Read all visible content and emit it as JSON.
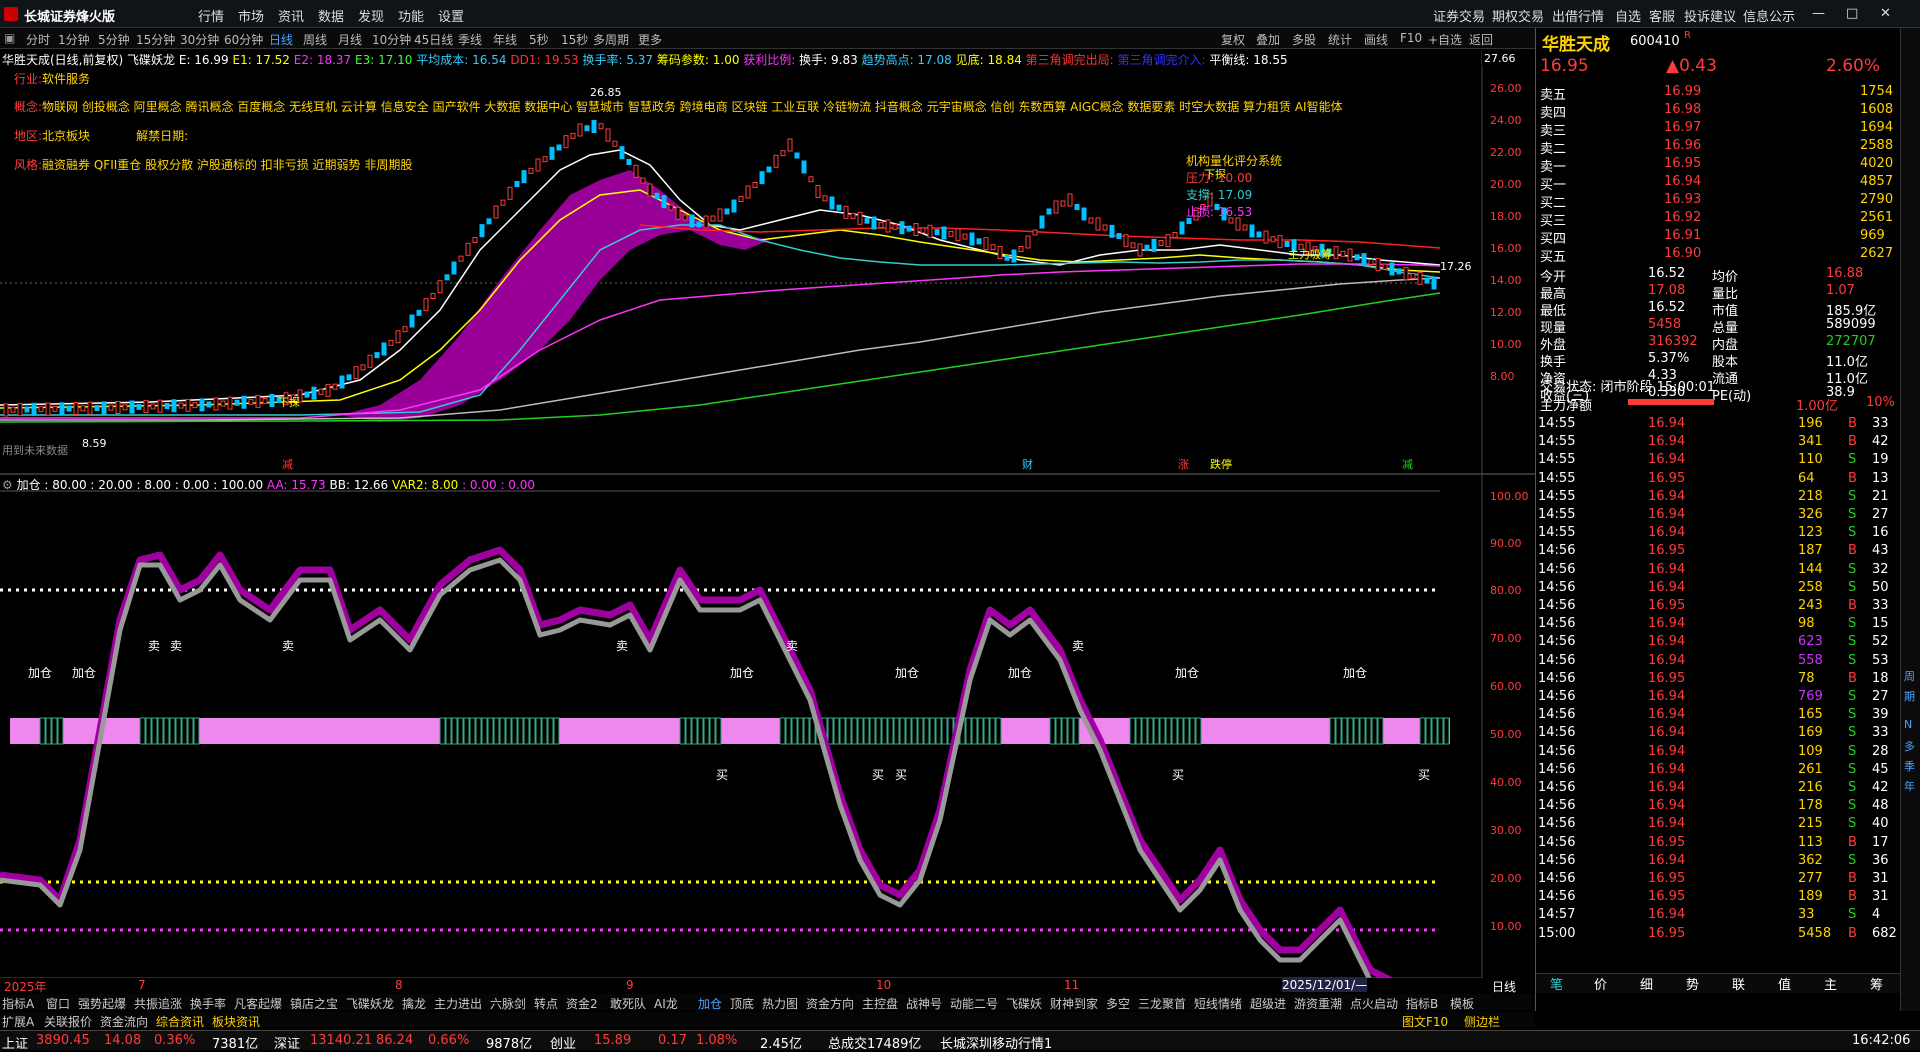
{
  "app": {
    "title": "长城证券烽火版",
    "menu": [
      "行情",
      "市场",
      "资讯",
      "数据",
      "发现",
      "功能",
      "设置"
    ],
    "right_menu": [
      "证券交易",
      "期权交易",
      "出借行情",
      "自选",
      "客服",
      "投诉建议",
      "信息公示"
    ]
  },
  "periods": [
    "分时",
    "1分钟",
    "5分钟",
    "15分钟",
    "30分钟",
    "60分钟",
    "日线",
    "周线",
    "月线",
    "10分钟",
    "45日线",
    "季线",
    "年线",
    "5秒",
    "15秒",
    "多周期",
    "更多"
  ],
  "toolbar_right": [
    "复权",
    "叠加",
    "多股",
    "统计",
    "画线",
    "F10",
    "+自选",
    "返回"
  ],
  "info_line": [
    {
      "t": "华胜天成(日线,前复权)",
      "c": "#ffffff"
    },
    {
      "t": "飞碟妖龙",
      "c": "#ffffff"
    },
    {
      "t": "E: 16.99",
      "c": "#ffffff"
    },
    {
      "t": "E1: 17.52",
      "c": "#ffff00"
    },
    {
      "t": "E2: 18.37",
      "c": "#ff33ff"
    },
    {
      "t": "E3: 17.10",
      "c": "#33ff33"
    },
    {
      "t": "平均成本: 16.54",
      "c": "#33ccff"
    },
    {
      "t": "DD1: 19.53",
      "c": "#ff3333"
    },
    {
      "t": "换手率: 5.37",
      "c": "#33ccff"
    },
    {
      "t": "筹码参数: 1.00",
      "c": "#ffff00"
    },
    {
      "t": "获利比例:",
      "c": "#ff33ff"
    },
    {
      "t": "换手: 9.83",
      "c": "#ffffff"
    },
    {
      "t": "趋势高点: 17.08",
      "c": "#33ccff"
    },
    {
      "t": "见底: 18.84",
      "c": "#ffff00"
    },
    {
      "t": "第三角调完出局:",
      "c": "#ff3333"
    },
    {
      "t": "第三角调完介入:",
      "c": "#3333ff"
    },
    {
      "t": "平衡线: 18.55",
      "c": "#ffffff"
    }
  ],
  "industry": {
    "label": "行业:",
    "value": "软件服务"
  },
  "concepts": {
    "label": "概念:",
    "value": "物联网 创投概念 阿里概念 腾讯概念 百度概念 无线耳机 云计算 信息安全 国产软件 大数据 数据中心 智慧城市 智慧政务 跨境电商 区块链 工业互联 冷链物流 抖音概念 元宇宙概念 信创 东数西算 AIGC概念 数据要素 时空大数据 算力租赁 AI智能体"
  },
  "region": {
    "label": "地区:",
    "value": "北京板块",
    "ban_label": "解禁日期:"
  },
  "style": {
    "label": "风格:",
    "value": "融资融券 QFII重仓 股权分散 沪股通标的 扣非亏损 近期弱势 非周期股"
  },
  "price_axis": [
    "26.00",
    "24.00",
    "22.00",
    "20.00",
    "18.00",
    "16.00",
    "14.00",
    "12.00",
    "10.00",
    "8.00"
  ],
  "price_max": "27.66",
  "price_min": "8.59",
  "price_peak": "26.85",
  "price_last": "17.26",
  "panel_box": {
    "title": "机构量化评分系统",
    "items": [
      {
        "label": "压力:",
        "value": "10.00"
      },
      {
        "label": "支撑:",
        "value": "17.09"
      },
      {
        "label": "止损:",
        "value": "16.53"
      }
    ]
  },
  "chart_marks": [
    "下探",
    "龙",
    "王",
    "主力吸筹",
    "用到未来数据"
  ],
  "event_marks": [
    "减",
    "财",
    "涨",
    "跌停",
    "减"
  ],
  "ind_line": [
    {
      "t": "加仓 : 80.00 : 20.00 : 8.00 : 0.00 : 100.00",
      "c": "#ffffff"
    },
    {
      "t": "AA: 15.73",
      "c": "#ff33ff"
    },
    {
      "t": "BB: 12.66",
      "c": "#ffffff"
    },
    {
      "t": "VAR2: 8.00",
      "c": "#ffff00"
    },
    {
      "t": ": 0.00 : 0.00",
      "c": "#ff33ff"
    }
  ],
  "ind_axis": [
    "100.00",
    "90.00",
    "80.00",
    "70.00",
    "60.00",
    "50.00",
    "40.00",
    "30.00",
    "20.00",
    "10.00"
  ],
  "ind_marks": {
    "sell": "卖",
    "buy": "买",
    "add": "加仓"
  },
  "x_axis": [
    "2025年",
    "7",
    "8",
    "9",
    "10",
    "11",
    "2025/12/01/—"
  ],
  "x_right": "日线",
  "tabs1": [
    "指标A",
    "窗口",
    "强势起爆",
    "共振追涨",
    "换手率",
    "凡客起爆",
    "镇店之宝",
    "飞碟妖龙",
    "擒龙",
    "主力进出",
    "六脉剑",
    "转点",
    "资金2",
    "敢死队",
    "AI龙",
    "加仓",
    "顶底",
    "热力图",
    "资金方向",
    "主控盘",
    "战神号",
    "动能二号",
    "飞碟妖",
    "财神到家",
    "多空",
    "三龙聚首",
    "短线情绪",
    "超级进",
    "游资重潮",
    "点火启动",
    "指标B",
    "模板"
  ],
  "tabs2": [
    "扩展A",
    "关联报价",
    "资金流向",
    "综合资讯",
    "板块资讯"
  ],
  "tabs2_right": [
    "图文F10",
    "侧边栏"
  ],
  "quote": {
    "name": "华胜天成",
    "code": "600410",
    "r": "R",
    "price": "16.95",
    "change": "▲0.43",
    "pct": "2.60%",
    "sells": [
      {
        "l": "卖五",
        "p": "16.99",
        "v": "1754"
      },
      {
        "l": "卖四",
        "p": "16.98",
        "v": "1608"
      },
      {
        "l": "卖三",
        "p": "16.97",
        "v": "1694"
      },
      {
        "l": "卖二",
        "p": "16.96",
        "v": "2588"
      },
      {
        "l": "卖一",
        "p": "16.95",
        "v": "4020"
      }
    ],
    "buys": [
      {
        "l": "买一",
        "p": "16.94",
        "v": "4857"
      },
      {
        "l": "买二",
        "p": "16.93",
        "v": "2790"
      },
      {
        "l": "买三",
        "p": "16.92",
        "v": "2561"
      },
      {
        "l": "买四",
        "p": "16.91",
        "v": "969"
      },
      {
        "l": "买五",
        "p": "16.90",
        "v": "2627"
      }
    ],
    "stats": [
      {
        "a": "今开",
        "b": "16.52",
        "c": "均价",
        "d": "16.88",
        "bc": "#ffffff",
        "dc": "#ff3b3b"
      },
      {
        "a": "最高",
        "b": "17.08",
        "c": "量比",
        "d": "1.07",
        "bc": "#ff3b3b",
        "dc": "#ff3b3b"
      },
      {
        "a": "最低",
        "b": "16.52",
        "c": "市值",
        "d": "185.9亿",
        "bc": "#ffffff",
        "dc": "#ffffff"
      },
      {
        "a": "现量",
        "b": "5458",
        "c": "总量",
        "d": "589099",
        "bc": "#ff3b3b",
        "dc": "#ffffff"
      },
      {
        "a": "外盘",
        "b": "316392",
        "c": "内盘",
        "d": "272707",
        "bc": "#ff3b3b",
        "dc": "#20d020"
      },
      {
        "a": "换手",
        "b": "5.37%",
        "c": "股本",
        "d": "11.0亿",
        "bc": "#ffffff",
        "dc": "#ffffff"
      },
      {
        "a": "净资",
        "b": "4.33",
        "c": "流通",
        "d": "11.0亿",
        "bc": "#ffffff",
        "dc": "#ffffff"
      },
      {
        "a": "收益(三)",
        "b": "0.330",
        "c": "PE(动)",
        "d": "38.9",
        "bc": "#ffffff",
        "dc": "#ffffff"
      }
    ],
    "trade_state": "交易状态: 闭市阶段 15:00:01",
    "main_net": {
      "label": "主力净额",
      "value": "1.00亿",
      "pct": "10%"
    },
    "ticks": [
      [
        "14:55",
        "16.94",
        "196",
        "B",
        "33"
      ],
      [
        "14:55",
        "16.94",
        "341",
        "B",
        "42"
      ],
      [
        "14:55",
        "16.94",
        "110",
        "S",
        "19"
      ],
      [
        "14:55",
        "16.95",
        "64",
        "B",
        "13"
      ],
      [
        "14:55",
        "16.94",
        "218",
        "S",
        "21"
      ],
      [
        "14:55",
        "16.94",
        "326",
        "S",
        "27"
      ],
      [
        "14:55",
        "16.94",
        "123",
        "S",
        "16"
      ],
      [
        "14:56",
        "16.95",
        "187",
        "B",
        "43"
      ],
      [
        "14:56",
        "16.94",
        "144",
        "S",
        "32"
      ],
      [
        "14:56",
        "16.94",
        "258",
        "S",
        "50"
      ],
      [
        "14:56",
        "16.95",
        "243",
        "B",
        "33"
      ],
      [
        "14:56",
        "16.94",
        "98",
        "S",
        "15"
      ],
      [
        "14:56",
        "16.94",
        "623",
        "S",
        "52"
      ],
      [
        "14:56",
        "16.94",
        "558",
        "S",
        "53"
      ],
      [
        "14:56",
        "16.95",
        "78",
        "B",
        "18"
      ],
      [
        "14:56",
        "16.94",
        "769",
        "S",
        "27"
      ],
      [
        "14:56",
        "16.94",
        "165",
        "S",
        "39"
      ],
      [
        "14:56",
        "16.94",
        "169",
        "S",
        "33"
      ],
      [
        "14:56",
        "16.94",
        "109",
        "S",
        "28"
      ],
      [
        "14:56",
        "16.94",
        "261",
        "S",
        "45"
      ],
      [
        "14:56",
        "16.94",
        "216",
        "S",
        "42"
      ],
      [
        "14:56",
        "16.94",
        "178",
        "S",
        "48"
      ],
      [
        "14:56",
        "16.94",
        "215",
        "S",
        "40"
      ],
      [
        "14:56",
        "16.95",
        "113",
        "B",
        "17"
      ],
      [
        "14:56",
        "16.94",
        "362",
        "S",
        "36"
      ],
      [
        "14:56",
        "16.95",
        "277",
        "B",
        "31"
      ],
      [
        "14:56",
        "16.95",
        "189",
        "B",
        "31"
      ],
      [
        "14:57",
        "16.94",
        "33",
        "S",
        "4"
      ],
      [
        "15:00",
        "16.95",
        "5458",
        "B",
        "682"
      ]
    ],
    "bottom_tabs": [
      "笔",
      "价",
      "细",
      "势",
      "联",
      "值",
      "主",
      "筹"
    ]
  },
  "right_strip": [
    "周",
    "期",
    "N",
    "多",
    "季",
    "年"
  ],
  "status": {
    "sh_label": "上证",
    "sh": "3890.45",
    "sh_chg": "14.08",
    "sh_pct": "0.36%",
    "sh_amt": "7381亿",
    "sz_label": "深证",
    "sz": "13140.21",
    "sz_chg": "86.24",
    "sz_pct": "0.66%",
    "sz_amt": "9878亿",
    "cy_label": "创业",
    "cy": "15.89",
    "cy_chg": "0.17",
    "cy_pct": "1.08%",
    "cy_amt": "2.45亿",
    "total": "总成交17489亿",
    "server": "长城深圳移动行情1",
    "time": "16:42:06"
  },
  "colors": {
    "up": "#ff3b3b",
    "down": "#20d020",
    "bg": "#000000",
    "magenta": "#a000a0"
  }
}
